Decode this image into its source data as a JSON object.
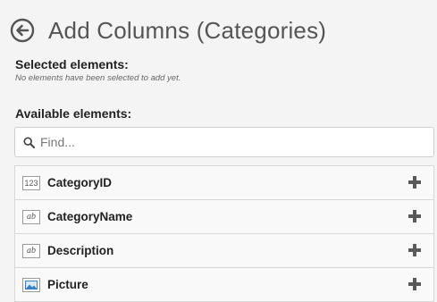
{
  "header": {
    "title": "Add Columns (Categories)"
  },
  "selected": {
    "label": "Selected elements:",
    "empty_hint": "No elements have been selected to add yet."
  },
  "available": {
    "label": "Available elements:"
  },
  "search": {
    "placeholder": "Find..."
  },
  "items": [
    {
      "type": "numeric",
      "type_text": "123",
      "label": "CategoryID"
    },
    {
      "type": "text",
      "type_text": "ab",
      "label": "CategoryName"
    },
    {
      "type": "text",
      "type_text": "ab",
      "label": "Description"
    },
    {
      "type": "image",
      "type_text": "",
      "label": "Picture"
    }
  ],
  "colors": {
    "image_icon": "#3b7fc4",
    "plus": "#5a5a5a"
  }
}
